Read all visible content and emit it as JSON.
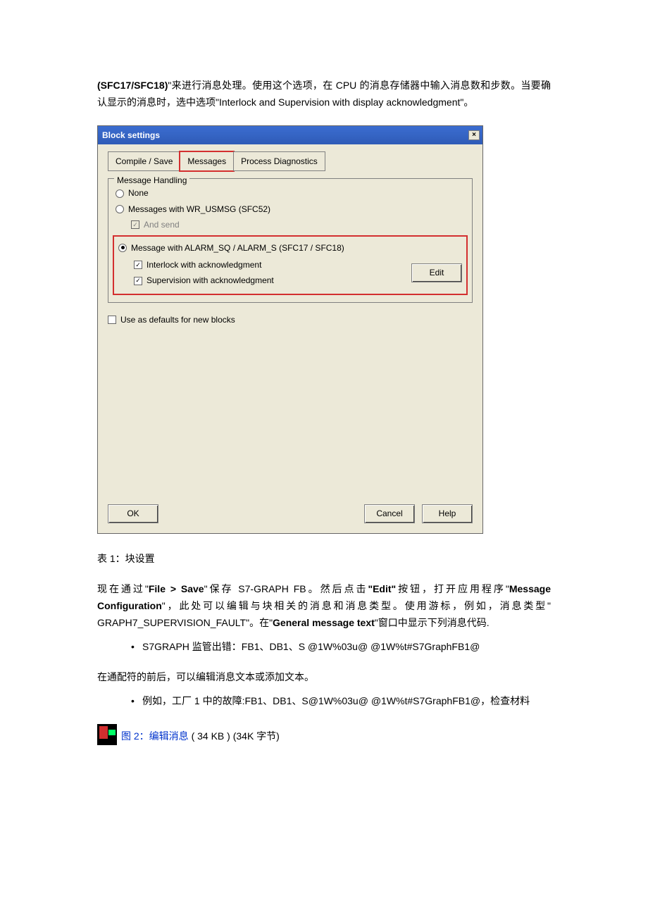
{
  "paragraphs": {
    "p1a": "(SFC17/SFC18)",
    "p1b": "\"来进行消息处理。使用这个选项，在 CPU 的消息存储器中输入消息数和步数。当要确认显示的消息时，选中选项\"Interlock and Supervision with display acknowledgment\"。",
    "caption1": "表 1：块设置",
    "p2a": "现在通过\"",
    "p2b": "File > Save",
    "p2c": "\"保存 S7-GRAPH FB。然后点击",
    "p2d": "\"Edit\"",
    "p2e": "按钮，打开应用程序\"",
    "p2f": "Message Configuration",
    "p2g": "\"，此处可以编辑与块相关的消息和消息类型。使用游标，例如，消息类型\" GRAPH7_SUPERVISION_FAULT\"。在\"",
    "p2h": "General message text",
    "p2i": "\"窗口中显示下列消息代码.",
    "bullet1": "S7GRAPH 监管出错：FB1、DB1、S @1W%03u@  @1W%t#S7GraphFB1@",
    "p3": "在通配符的前后，可以编辑消息文本或添加文本。",
    "bullet2": "例如，工厂 1 中的故障:FB1、DB1、S@1W%03u@  @1W%t#S7GraphFB1@，检查材料",
    "attach_link": "图 2：编辑消息",
    "attach_size": "( 34 KB ) (34K 字节)"
  },
  "dialog": {
    "title": "Block settings",
    "close": "×",
    "tabs": {
      "t1": "Compile / Save",
      "t2": "Messages",
      "t3": "Process Diagnostics"
    },
    "fieldset_title": "Message Handling",
    "opt_none": "None",
    "opt_sfc52": "Messages with WR_USMSG (SFC52)",
    "opt_andsend": "And send",
    "opt_alarm": "Message with ALARM_SQ / ALARM_S (SFC17 / SFC18)",
    "opt_interlock": "Interlock with acknowledgment",
    "opt_supervision": "Supervision with acknowledgment",
    "edit_btn": "Edit",
    "defaults": "Use as defaults for new blocks",
    "ok": "OK",
    "cancel": "Cancel",
    "help": "Help"
  }
}
